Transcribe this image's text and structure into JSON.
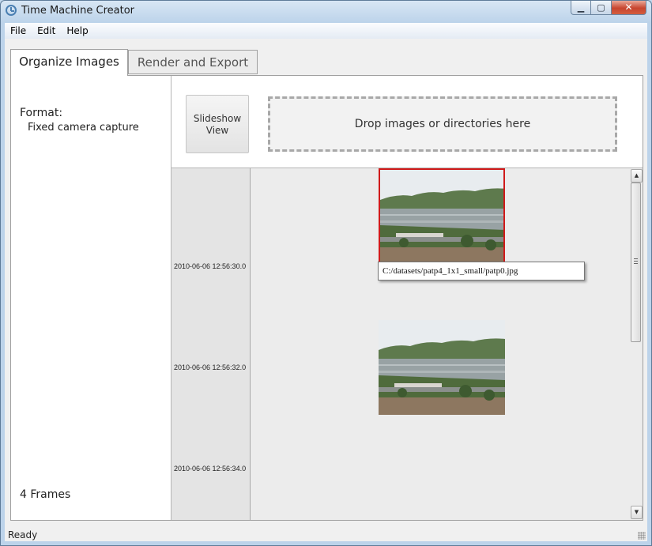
{
  "window": {
    "title": "Time Machine Creator",
    "min_glyph": "▁",
    "max_glyph": "▢",
    "close_glyph": "✕"
  },
  "menu": {
    "items": [
      "File",
      "Edit",
      "Help"
    ]
  },
  "tabs": [
    {
      "label": "Organize Images",
      "active": true
    },
    {
      "label": "Render and Export",
      "active": false
    }
  ],
  "left_panel": {
    "format_label": "Format:",
    "format_value": "Fixed camera capture",
    "frames_count": "4 Frames"
  },
  "toolbar": {
    "slideshow_line1": "Slideshow",
    "slideshow_line2": "View",
    "drop_zone": "Drop images or directories here"
  },
  "frames": [
    {
      "timestamp": "2010-06-06 12:56:30.0",
      "selected": true
    },
    {
      "timestamp": "2010-06-06 12:56:32.0",
      "selected": false
    },
    {
      "timestamp": "2010-06-06 12:56:34.0",
      "selected": false
    }
  ],
  "tooltip": {
    "text": "C:/datasets/patp4_1x1_small/patp0.jpg"
  },
  "scrollbar": {
    "up_glyph": "▲",
    "down_glyph": "▼"
  },
  "status": {
    "text": "Ready"
  },
  "colors": {
    "selection_border": "#d01a1a",
    "title_bar": "#bcd3ea",
    "close_button": "#c7452f"
  }
}
